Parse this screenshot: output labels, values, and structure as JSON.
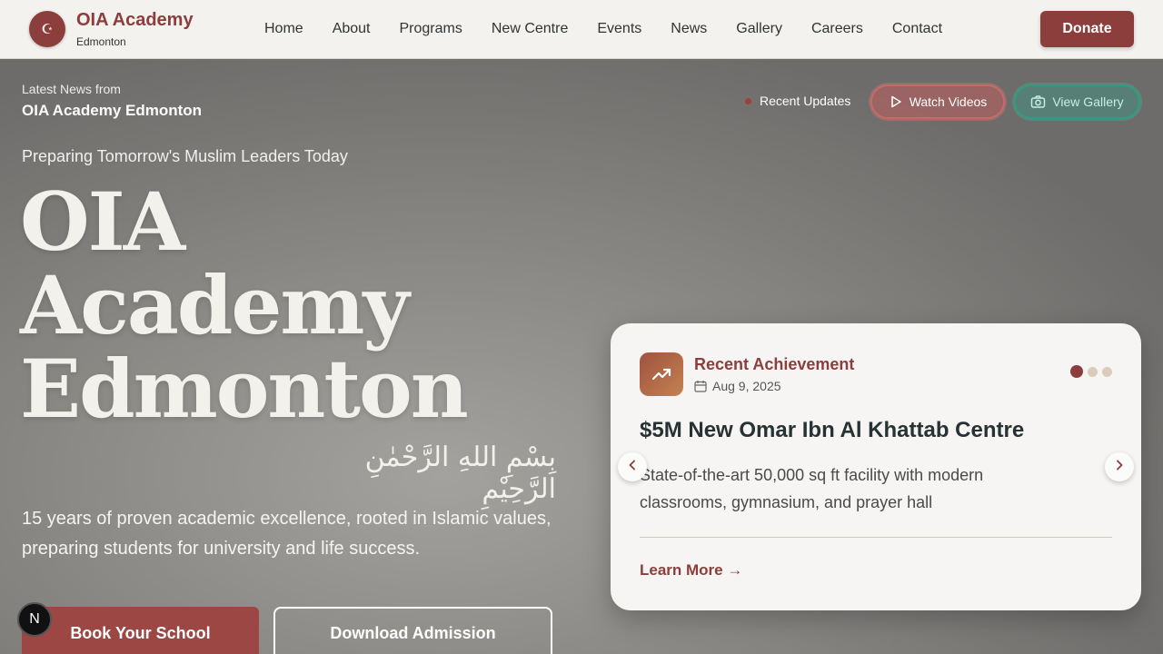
{
  "nav": {
    "logo_icon": "crescent-moon-icon",
    "logo_name": "OIA Academy",
    "logo_sub": "Edmonton",
    "items": [
      {
        "label": "Home"
      },
      {
        "label": "About"
      },
      {
        "label": "Programs"
      },
      {
        "label": "New Centre"
      },
      {
        "label": "Events"
      },
      {
        "label": "News"
      },
      {
        "label": "Gallery"
      },
      {
        "label": "Careers"
      },
      {
        "label": "Contact"
      }
    ],
    "donate_label": "Donate"
  },
  "hero": {
    "latest_label": "Latest News from",
    "latest_school": "OIA Academy Edmonton",
    "updates_label": "Recent Updates",
    "watch_label": "Watch Videos",
    "gallery_label": "View Gallery",
    "tagline": "Preparing Tomorrow's Muslim Leaders Today",
    "title_lines": [
      "OIA",
      "Academy",
      "Edmonton"
    ],
    "arabic": "بِسْمِ اللهِ الرَّحْمٰنِ الرَّحِيْمِ",
    "description": "15 years of proven academic excellence, rooted in Islamic values, preparing students for university and life success.",
    "book_label": "Book Your School",
    "download_label": "Download Admission",
    "badge_letter": "N"
  },
  "card": {
    "category": "Recent Achievement",
    "date": "Aug 9, 2025",
    "title": "$5M New Omar Ibn Al Khattab Centre",
    "text": "State-of-the-art 50,000 sq ft facility with modern classrooms, gymnasium, and prayer hall",
    "link": "Learn More →",
    "slide_count": 3,
    "active_slide": 1
  },
  "colors": {
    "brand": "#8b3e3c",
    "watch_accent": "#c86a68",
    "gallery_accent": "#2f9c84"
  }
}
